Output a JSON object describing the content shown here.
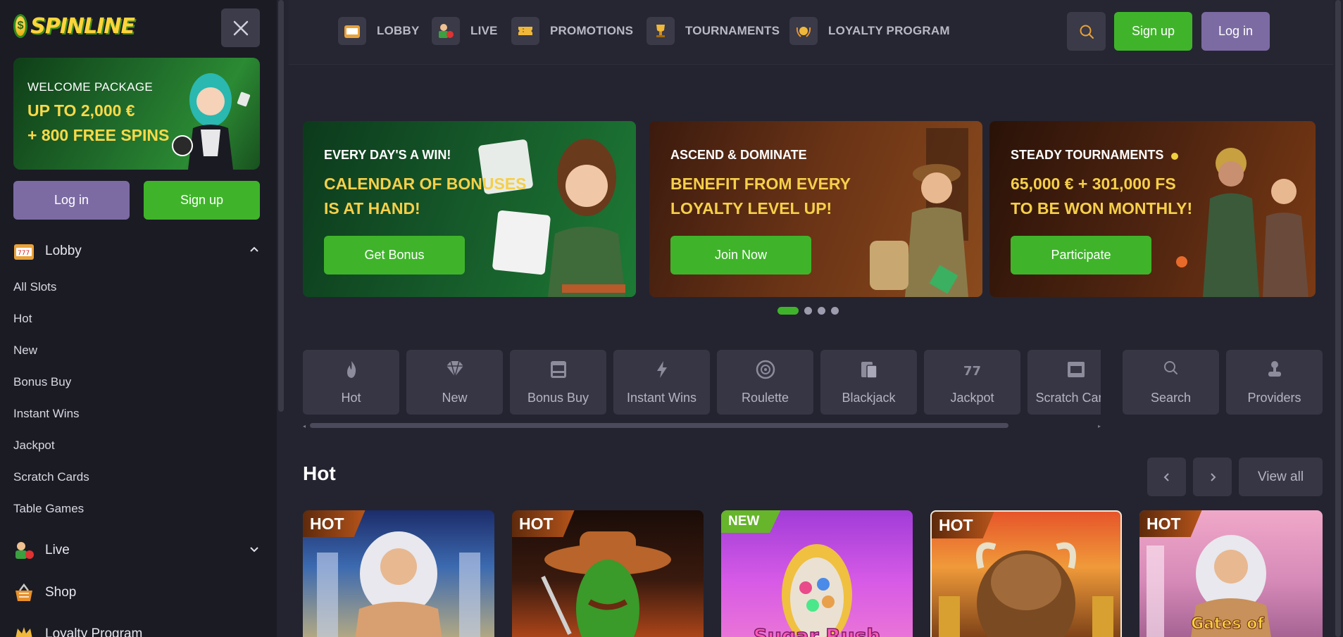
{
  "brand": {
    "logo_text": "SPINLINE"
  },
  "sidebar": {
    "welcome": {
      "subtitle": "WELCOME PACKAGE",
      "line1": "UP TO 2,000 €",
      "line2": "+ 800 FREE SPINS"
    },
    "login_label": "Log in",
    "signup_label": "Sign up",
    "lobby_label": "Lobby",
    "sub_items": [
      "All Slots",
      "Hot",
      "New",
      "Bonus Buy",
      "Instant Wins",
      "Jackpot",
      "Scratch Cards",
      "Table Games"
    ],
    "live_label": "Live",
    "shop_label": "Shop",
    "loyalty_label": "Loyalty Program"
  },
  "header": {
    "nav": [
      "LOBBY",
      "LIVE",
      "PROMOTIONS",
      "TOURNAMENTS",
      "LOYALTY PROGRAM"
    ],
    "signup_label": "Sign up",
    "login_label": "Log in"
  },
  "promos": [
    {
      "head": "EVERY DAY'S A WIN!",
      "line1": "CALENDAR OF BONUSES",
      "line2": "IS AT HAND!",
      "button": "Get Bonus"
    },
    {
      "head": "ASCEND & DOMINATE",
      "line1": "BENEFIT FROM EVERY",
      "line2": "LOYALTY LEVEL UP!",
      "button": "Join Now"
    },
    {
      "head": "STEADY TOURNAMENTS",
      "line1": "65,000 € + 301,000 FS",
      "line2": "TO BE WON MONTHLY!",
      "button": "Participate"
    }
  ],
  "carousel": {
    "active_index": 0,
    "count": 4
  },
  "categories": [
    "Hot",
    "New",
    "Bonus Buy",
    "Instant Wins",
    "Roulette",
    "Blackjack",
    "Jackpot",
    "Scratch Cards"
  ],
  "extra_tabs": {
    "search": "Search",
    "providers": "Providers"
  },
  "hot_section": {
    "title": "Hot",
    "view_all": "View all",
    "badges": [
      "HOT",
      "HOT",
      "NEW",
      "HOT",
      "HOT"
    ],
    "visible_titles": [
      "Sugar Rush",
      "Gates of"
    ]
  },
  "colors": {
    "accent_green": "#3fb42a",
    "accent_purple": "#7c6ba3",
    "gold": "#f5cf4a",
    "background": "#242430",
    "sidebar": "#1b1b24"
  }
}
